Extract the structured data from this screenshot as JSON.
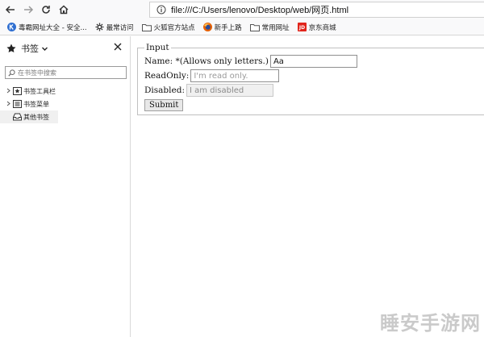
{
  "url": "file:///C:/Users/lenovo/Desktop/web/网页.html",
  "bookmarks_toolbar": {
    "items": [
      {
        "label": "毒霸网址大全 - 安全...",
        "icon": "k-logo-icon"
      },
      {
        "label": "最常访问",
        "icon": "gear-icon"
      },
      {
        "label": "火狐官方站点",
        "icon": "folder-icon"
      },
      {
        "label": "新手上路",
        "icon": "firefox-icon"
      },
      {
        "label": "常用网址",
        "icon": "folder-icon"
      },
      {
        "label": "京东商城",
        "icon": "jd-icon"
      }
    ]
  },
  "sidebar": {
    "title": "书签",
    "search_placeholder": "在书签中搜索",
    "tree": [
      {
        "label": "书签工具栏",
        "icon": "star-box-icon",
        "expandable": true
      },
      {
        "label": "书签菜单",
        "icon": "menu-list-icon",
        "expandable": true
      },
      {
        "label": "其他书签",
        "icon": "inbox-icon",
        "expandable": false,
        "selected": true
      }
    ]
  },
  "form": {
    "legend": "Input",
    "name_label": "Name: *(Allows only letters.)",
    "name_value": "Aa",
    "readonly_label": "ReadOnly:",
    "readonly_placeholder": "I'm read only.",
    "disabled_label": "Disabled:",
    "disabled_value": "I am disabled",
    "submit_label": "Submit"
  },
  "watermark": "睡安手游网",
  "colors": {
    "toolbar_bg": "#f9f9fa",
    "k_logo": "#2f6fd1",
    "jd_red": "#e1251b",
    "folder": "#555555"
  }
}
